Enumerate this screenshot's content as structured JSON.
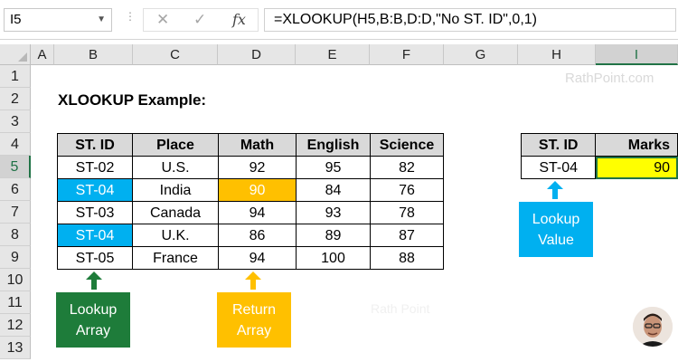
{
  "formula_bar": {
    "name_box": "I5",
    "cancel_icon": "cancel-icon",
    "enter_icon": "enter-icon",
    "fx_label": "fx",
    "formula": "=XLOOKUP(H5,B:B,D:D,\"No ST. ID\",0,1)"
  },
  "sheet": {
    "columns": [
      "A",
      "B",
      "C",
      "D",
      "E",
      "F",
      "G",
      "H",
      "I"
    ],
    "rows": [
      "1",
      "2",
      "3",
      "4",
      "5",
      "6",
      "7",
      "8",
      "9",
      "10",
      "11",
      "12",
      "13"
    ],
    "selected_column": "I",
    "selected_row": "5",
    "title": "XLOOKUP Example:",
    "watermark": "RathPoint.com",
    "watermark_faint": "Rath Point"
  },
  "main_table": {
    "headers": [
      "ST. ID",
      "Place",
      "Math",
      "English",
      "Science"
    ],
    "rows": [
      [
        "ST-02",
        "U.S.",
        "92",
        "95",
        "82"
      ],
      [
        "ST-04",
        "India",
        "90",
        "84",
        "76"
      ],
      [
        "ST-03",
        "Canada",
        "94",
        "93",
        "78"
      ],
      [
        "ST-04",
        "U.K.",
        "86",
        "89",
        "87"
      ],
      [
        "ST-05",
        "France",
        "94",
        "100",
        "88"
      ]
    ]
  },
  "lookup_table": {
    "headers": [
      "ST. ID",
      "Marks"
    ],
    "row": [
      "ST-04",
      "90"
    ]
  },
  "callouts": {
    "lookup_array": [
      "Lookup",
      "Array"
    ],
    "return_array": [
      "Return",
      "Array"
    ],
    "lookup_value": [
      "Lookup",
      "Value"
    ]
  },
  "colors": {
    "highlight_cyan": "#00b0f0",
    "highlight_orange": "#ffc000",
    "result_yellow": "#ffff00",
    "callout_green": "#1e7c3a",
    "excel_green": "#217346"
  }
}
